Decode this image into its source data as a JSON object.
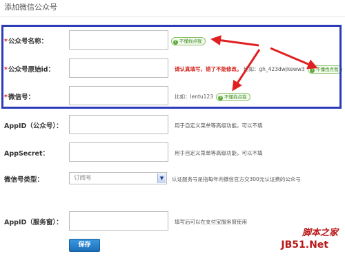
{
  "page": {
    "title": "添加微信公众号"
  },
  "form": {
    "fields": [
      {
        "required": "*",
        "label": "公众号名称：",
        "help_pill": "不懂找点我"
      },
      {
        "required": "*",
        "label": "公众号原始id：",
        "warning": "请认真填写，错了不能修改。",
        "example": "比如：gh_423dwjkeww3",
        "help_pill": "不懂找点我"
      },
      {
        "required": "*",
        "label": "微信号：",
        "example": "比如：lentu123",
        "help_pill": "不懂找点我"
      },
      {
        "label": "AppID（公众号）：",
        "help": "用于自定义菜单等高级功能，可以不填"
      },
      {
        "label": "AppSecret：",
        "help": "用于自定义菜单等高级功能，可以不填"
      },
      {
        "label": "微信号类型：",
        "select_value": "订阅号",
        "help": "认证服务号是指每年向微信官方交300元认证费的公众号"
      },
      {
        "label": "AppID（服务窗）：",
        "help": "填写后可以在支付宝服务窗使用"
      }
    ],
    "save_label": "保存"
  },
  "watermark": {
    "line1": "脚本之家",
    "line2": "JB51.Net"
  },
  "colors": {
    "annotation": "#e02020",
    "highlight_box": "#2c3bb8",
    "button": "#1c6fb8"
  }
}
